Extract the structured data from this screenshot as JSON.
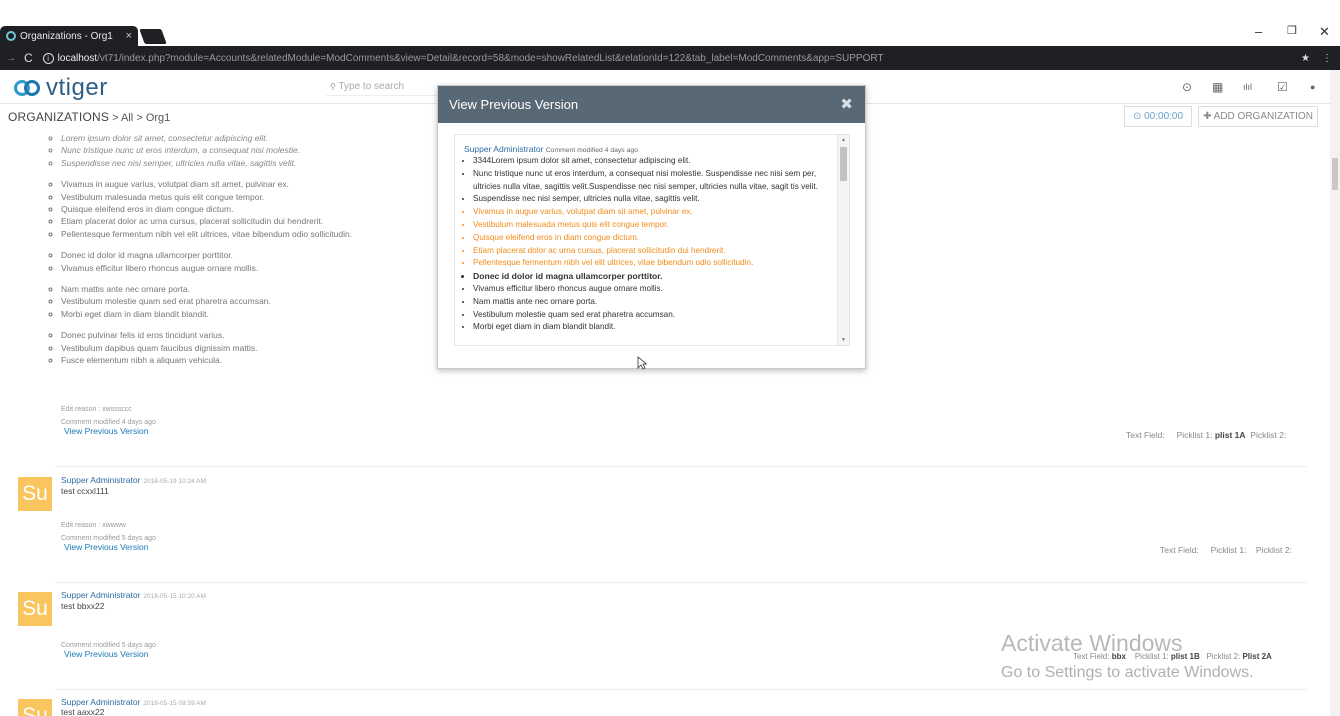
{
  "browser": {
    "tab_title": "Organizations - Org1",
    "tab_close": "×",
    "url_host": "localhost",
    "url_rest": "/vt71/index.php?module=Accounts&relatedModule=ModComments&view=Detail&record=58&mode=showRelatedList&relationId=122&tab_label=ModComments&app=SUPPORT",
    "back": "→",
    "reload": "C",
    "info": "i",
    "minimize": "–",
    "restore": "❐",
    "close": "✕",
    "star": "★",
    "menu": "⋮"
  },
  "app": {
    "logo": "vtiger",
    "search_placeholder": "Type to search",
    "search_icon": "🔍",
    "header_icons": [
      "⊙",
      "▦",
      "ılıl",
      "☑",
      "●"
    ]
  },
  "breadcrumb": {
    "module": "ORGANIZATIONS",
    "sep1": ">",
    "all": "All",
    "sep2": ">",
    "record": "Org1"
  },
  "actions": {
    "timer": "⊙ 00:00:00",
    "add_org": "✚ ADD ORGANIZATION"
  },
  "comments": {
    "list_groups": [
      [
        "Lorem ipsum dolor sit amet, consectetur adipiscing elit.",
        "Nunc tristique nunc ut eros interdum, a consequat nisi molestie.",
        "Suspendisse nec nisi semper, ultricies nulla vitae, sagittis velit."
      ],
      [
        "Vivamus in augue varius, volutpat diam sit amet, pulvinar ex.",
        "Vestibulum malesuada metus quis elit congue tempor.",
        "Quisque eleifend eros in diam congue dictum.",
        "Etiam placerat dolor ac urna cursus, placerat sollicitudin dui hendrerit.",
        "Pellentesque fermentum nibh vel elit ultrices, vitae bibendum odio sollicitudin."
      ],
      [
        "Donec id dolor id magna ullamcorper porttitor.",
        "Vivamus efficitur libero rhoncus augue ornare mollis."
      ],
      [
        "Nam mattis ante nec ornare porta.",
        "Vestibulum molestie quam sed erat pharetra accumsan.",
        "Morbi eget diam in diam blandit blandit."
      ],
      [
        "Donec pulvinar felis id eros tincidunt varius.",
        "Vestibulum dapibus quam faucibus dignissim mattis.",
        "Fusce elementum nibh a aliquam vehicula."
      ]
    ],
    "c1": {
      "edit_reason": "Edit reason : xwsssccc",
      "modified": "Comment modified 4 days ago",
      "view_prev": "View Previous Version",
      "fields_label": "Text Field:",
      "picklist1_label": "Picklist 1:",
      "picklist1_value": "plist 1A",
      "picklist2_label": "Picklist 2:"
    },
    "c2": {
      "avatar": "Su",
      "author": "Supper Administrator",
      "timestamp": "2018-05-19 10:24 AM",
      "body": "test ccxxl111",
      "edit_reason": "Edit reason : xwwww",
      "modified": "Comment modified 5 days ago",
      "view_prev": "View Previous Version",
      "fields_label": "Text Field:",
      "picklist1_label": "Picklist 1:",
      "picklist2_label": "Picklist 2:"
    },
    "c3": {
      "avatar": "Su",
      "author": "Supper Administrator",
      "timestamp": "2018-05-15 10:20 AM",
      "body": "test bbxx22",
      "modified": "Comment modified 5 days ago",
      "view_prev": "View Previous Version",
      "fields_label": "Text Field:",
      "fields_value": "bbx",
      "picklist1_label": "Picklist 1:",
      "picklist1_value": "plist 1B",
      "picklist2_label": "Picklist 2:",
      "picklist2_value": "Plist 2A"
    },
    "c4": {
      "avatar": "Su",
      "author": "Supper Administrator",
      "timestamp": "2018-05-15 09:59 AM",
      "body": "test aaxx22"
    }
  },
  "modal": {
    "title": "View Previous Version",
    "close": "✖",
    "author": "Supper Administrator",
    "tag": "Comment modified 4 days ago",
    "items": [
      {
        "text": "3344Lorem ipsum dolor sit amet, consectetur adipiscing elit.",
        "style": "normal"
      },
      {
        "text": "Nunc tristique nunc ut eros interdum, a consequat nisi molestie. Suspendisse nec nisi sem per, ultricies nulla vitae, sagittis velit.Suspendisse nec nisi semper, ultricies nulla vitae, sagit tis velit.",
        "style": "normal"
      },
      {
        "text": "Suspendisse nec nisi semper, ultricies nulla vitae, sagittis velit.",
        "style": "normal"
      },
      {
        "text": "Vivamus in augue varius, volutpat diam sit amet, pulvinar ex.",
        "style": "orange"
      },
      {
        "text": "Vestibulum malesuada metus quis elit congue tempor.",
        "style": "orange"
      },
      {
        "text": "Quisque eleifend eros in diam congue dictum.",
        "style": "orange"
      },
      {
        "text": "Etiam placerat dolor ac urna cursus, placerat sollicitudin dui hendrerit.",
        "style": "orange"
      },
      {
        "text": "Pellentesque fermentum nibh vel elit ultrices, vitae bibendum odio sollicitudin.",
        "style": "orange"
      },
      {
        "text": "Donec id dolor id magna ullamcorper porttitor.",
        "style": "bold"
      },
      {
        "text": "Vivamus efficitur libero rhoncus augue ornare mollis.",
        "style": "normal"
      },
      {
        "text": "Nam mattis ante nec ornare porta.",
        "style": "normal"
      },
      {
        "text": "Vestibulum molestie quam sed erat pharetra accumsan.",
        "style": "normal"
      },
      {
        "text": "Morbi eget diam in diam blandit blandit.",
        "style": "normal"
      }
    ]
  },
  "watermark": {
    "line1": "Activate Windows",
    "line2": "Go to Settings to activate Windows."
  },
  "colors": {
    "accent": "#1a7ab8",
    "modal_header": "#596875",
    "highlight_orange": "#f28c1b",
    "avatar": "#f9c55e"
  }
}
